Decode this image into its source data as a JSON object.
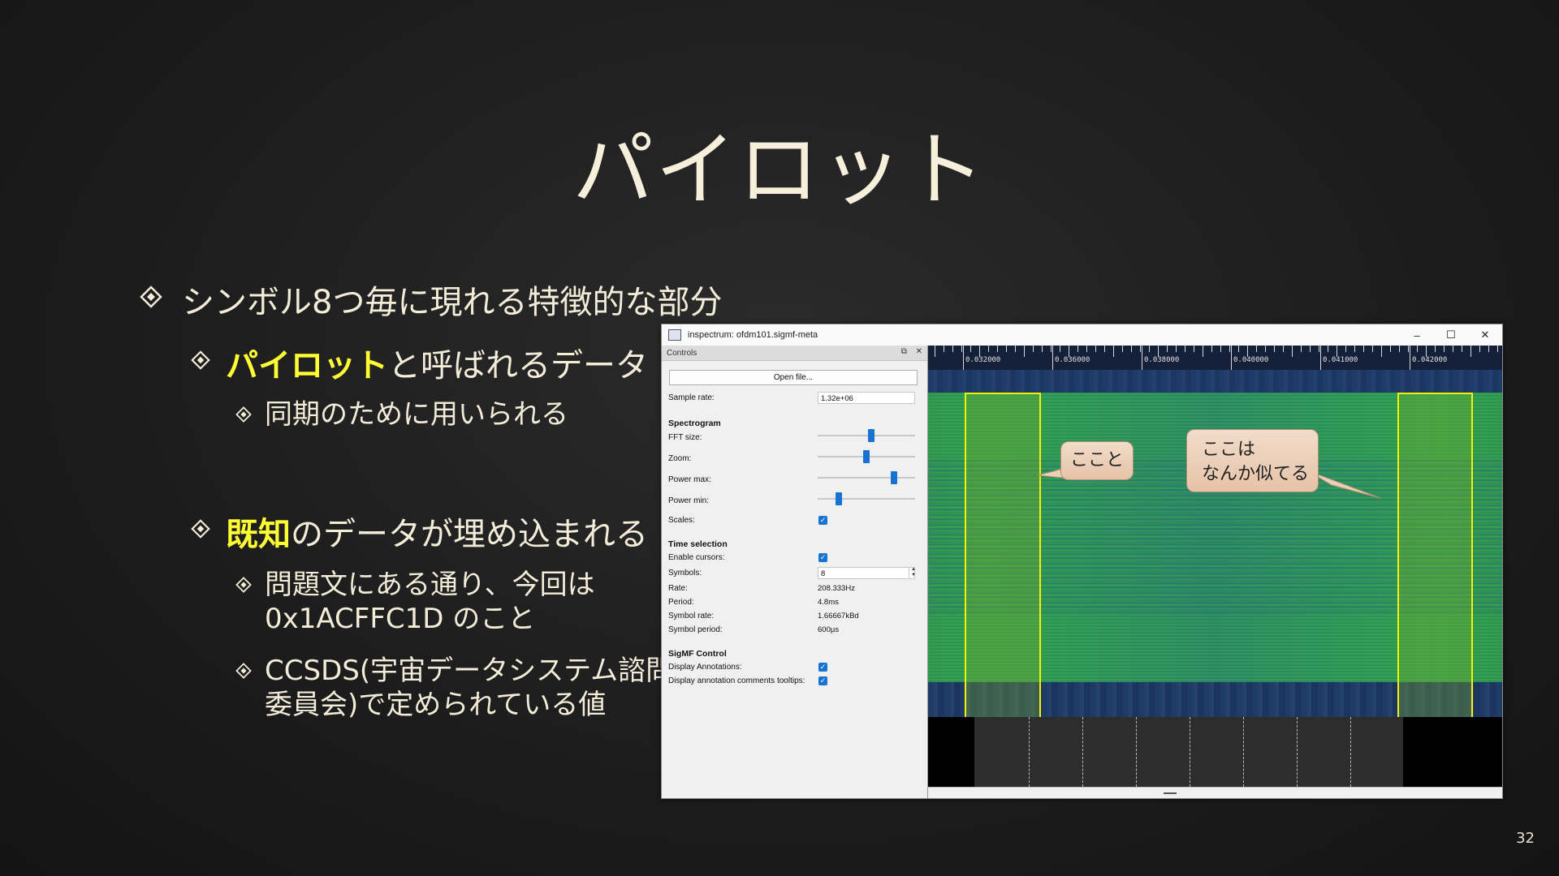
{
  "slide": {
    "title": "パイロット",
    "bullets": {
      "b1": "シンボル8つ毎に現れる特徴的な部分",
      "b2_highlight": "パイロット",
      "b2_rest": "と呼ばれるデータ",
      "b2_sub": "同期のために用いられる",
      "b3_highlight": "既知",
      "b3_rest": "のデータが埋め込まれる",
      "b3_sub1_line1": "問題文にある通り、今回は",
      "b3_sub1_line2": "0x1ACFFC1D のこと",
      "b3_sub2_line1": "CCSDS(宇宙データシステム諮問",
      "b3_sub2_line2": "委員会)で定められている値"
    },
    "page_number": "32"
  },
  "window": {
    "title": "inspectrum: ofdm101.sigmf-meta",
    "buttons": {
      "minimize": "–",
      "maximize": "☐",
      "close": "✕"
    },
    "controls": {
      "header": "Controls",
      "header_btns": [
        "⧉",
        "✕"
      ],
      "open_file": "Open file...",
      "sample_rate_label": "Sample rate:",
      "sample_rate_value": "1.32e+06",
      "spectrogram_header": "Spectrogram",
      "fft_label": "FFT size:",
      "fft_level": 0.55,
      "zoom_label": "Zoom:",
      "zoom_level": 0.5,
      "power_max_label": "Power max:",
      "power_max_level": 0.8,
      "power_min_label": "Power min:",
      "power_min_level": 0.2,
      "scales_label": "Scales:",
      "time_selection_header": "Time selection",
      "enable_cursors_label": "Enable cursors:",
      "symbols_label": "Symbols:",
      "symbols_value": "8",
      "rate_label": "Rate:",
      "rate_value": "208.333Hz",
      "period_label": "Period:",
      "period_value": "4.8ms",
      "symbol_rate_label": "Symbol rate:",
      "symbol_rate_value": "1.66667kBd",
      "symbol_period_label": "Symbol period:",
      "symbol_period_value": "600µs",
      "sigmf_header": "SigMF Control",
      "display_annotations_label": "Display Annotations:",
      "display_tooltips_label": "Display annotation comments tooltips:",
      "check_glyph": "✓"
    },
    "ruler_labels": [
      "0.032000",
      "0.036000",
      "0.038000",
      "0.040000",
      "0.041000",
      "0.042000"
    ]
  },
  "callouts": {
    "left": "ここと",
    "right_line1": "ここは",
    "right_line2": "なんか似てる"
  }
}
